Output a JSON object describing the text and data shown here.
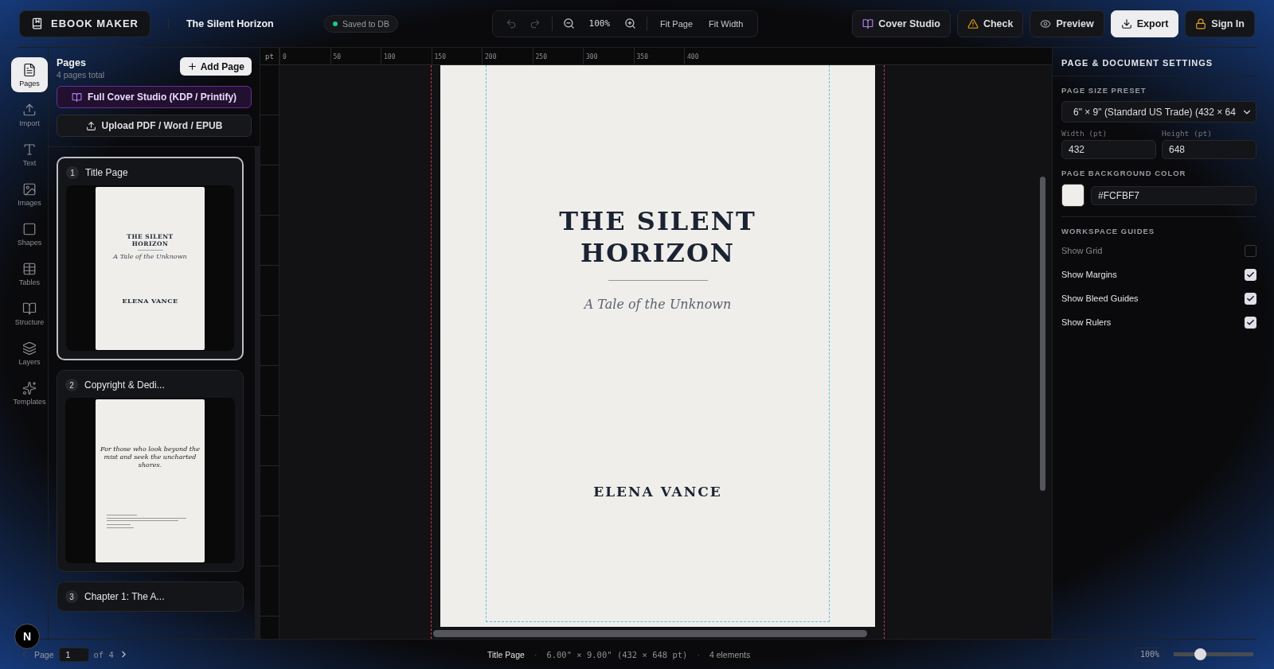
{
  "app": {
    "name": "EBOOK MAKER",
    "document_title": "The Silent Horizon",
    "save_status": "Saved to DB"
  },
  "toolbar": {
    "undo_disabled": true,
    "redo_disabled": true,
    "zoom": "100%",
    "buttons": [
      "Fit Page",
      "Fit Width"
    ]
  },
  "actions": [
    {
      "kind": "cover",
      "label": "Cover Studio"
    },
    {
      "kind": "check",
      "label": "Check"
    },
    {
      "kind": "preview",
      "label": "Preview"
    },
    {
      "kind": "export",
      "label": "Export"
    },
    {
      "kind": "signin",
      "label": "Sign In"
    }
  ],
  "tool_rail": [
    {
      "kind": "pages",
      "label": "Pages",
      "selected": true
    },
    {
      "kind": "import",
      "label": "Import",
      "selected": false
    },
    {
      "kind": "text",
      "label": "Text",
      "selected": false
    },
    {
      "kind": "images",
      "label": "Images",
      "selected": false
    },
    {
      "kind": "shapes",
      "label": "Shapes",
      "selected": false
    },
    {
      "kind": "tables",
      "label": "Tables",
      "selected": false
    },
    {
      "kind": "structure",
      "label": "Structure",
      "selected": false
    },
    {
      "kind": "layers",
      "label": "Layers",
      "selected": false
    },
    {
      "kind": "templates",
      "label": "Templates",
      "selected": false
    }
  ],
  "pages_panel": {
    "title": "Pages",
    "subtitle": "4 pages total",
    "add_button": "Add Page",
    "cover_button": "Full Cover Studio (KDP / Printify)",
    "upload_button": "Upload PDF / Word / EPUB",
    "pages": [
      {
        "number": "1",
        "title": "Title Page",
        "selected": true,
        "thumbnail": {
          "kind": "title",
          "title": "THE SILENT HORIZON",
          "subtitle": "A Tale of the Unknown",
          "author": "ELENA VANCE"
        }
      },
      {
        "number": "2",
        "title": "Copyright & Dedi...",
        "selected": false,
        "thumbnail": {
          "kind": "copyright",
          "dedication": "For those who look beyond the mist and seek the uncharted shores."
        }
      },
      {
        "number": "3",
        "title": "Chapter 1: The A...",
        "selected": false
      }
    ]
  },
  "ruler": {
    "unit": "pt",
    "ticks": [
      "0",
      "50",
      "100",
      "150",
      "200",
      "250",
      "300",
      "350",
      "400"
    ]
  },
  "page": {
    "title": "THE SILENT HORIZON",
    "subtitle": "A Tale of the Unknown",
    "author": "ELENA VANCE",
    "show_margins": true,
    "show_bleed": true
  },
  "settings": {
    "title": "PAGE & DOCUMENT SETTINGS",
    "preset_label": "PAGE SIZE PRESET",
    "preset_value": "6\" × 9\" (Standard US Trade) (432 × 64",
    "width_label": "Width (pt)",
    "width_value": "432",
    "height_label": "Height (pt)",
    "height_value": "648",
    "bg_label": "PAGE BACKGROUND COLOR",
    "bg_value": "#FCFBF7",
    "guides_label": "WORKSPACE GUIDES",
    "guides": [
      {
        "label": "Show Grid",
        "checked": false
      },
      {
        "label": "Show Margins",
        "checked": true
      },
      {
        "label": "Show Bleed Guides",
        "checked": true
      },
      {
        "label": "Show Rulers",
        "checked": true
      }
    ]
  },
  "status_bar": {
    "badge": "N",
    "page_label": "Page",
    "page_value": "1",
    "page_of": "of 4",
    "current_page": "Title Page",
    "separator_1": "·",
    "size": "6.00\" × 9.00\" (432 × 648 pt)",
    "separator_2": "·",
    "elements": "4 elements",
    "zoom": "100%",
    "zoom_slider": {
      "level": 0.3
    }
  }
}
